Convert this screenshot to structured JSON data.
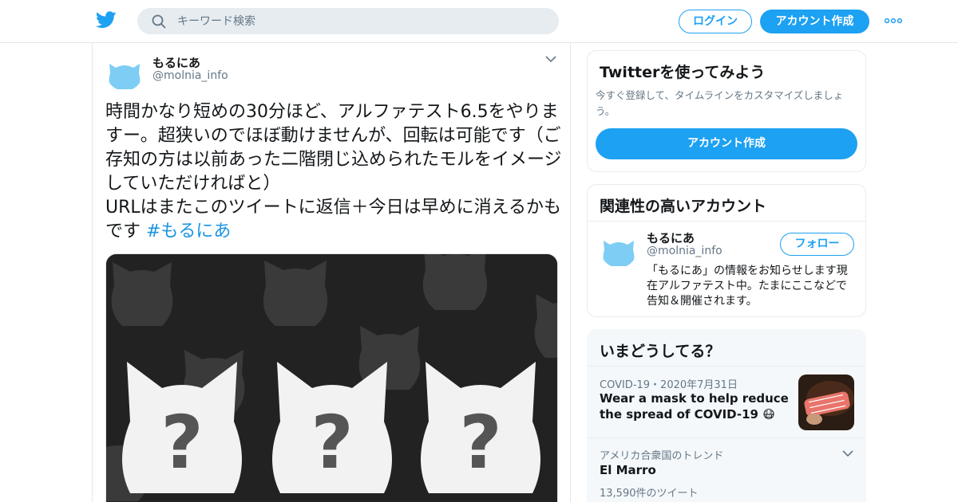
{
  "header": {
    "search_placeholder": "キーワード検索",
    "login_label": "ログイン",
    "signup_label": "アカウント作成"
  },
  "tweet": {
    "display_name": "もるにあ",
    "handle": "@molnia_info",
    "text": "時間かなり短めの30分ほど、アルファテスト6.5をやりますー。超狭いのでほぼ動けませんが、回転は可能です（ご存知の方は以前あった二階閉じ込められたモルをイメージしていただければと）\nURLはまたこのツイートに返信＋今日は早めに消えるかもです ",
    "hashtag": "#もるにあ",
    "media_question_marks": [
      "?",
      "?",
      "?"
    ]
  },
  "signup_card": {
    "title": "Twitterを使ってみよう",
    "description": "今すぐ登録して、タイムラインをカスタマイズしましょう。",
    "button_label": "アカウント作成"
  },
  "related_card": {
    "title": "関連性の高いアカウント",
    "account": {
      "display_name": "もるにあ",
      "handle": "@molnia_info",
      "follow_label": "フォロー",
      "bio": "「もるにあ」の情報をお知らせします現在アルファテスト中。たまにここなどで告知＆開催されます。"
    }
  },
  "trends_card": {
    "title": "いまどうしてる？",
    "items": [
      {
        "meta": "COVID-19・2020年7月31日",
        "title": "Wear a mask to help reduce the spread of COVID-19 😷"
      },
      {
        "meta": "アメリカ合衆国のトレンド",
        "title": "El Marro",
        "count": "13,590件のツイート"
      }
    ]
  },
  "colors": {
    "brand": "#1da1f2",
    "link": "#1b95e0",
    "avatar_blue": "#7ecdf5",
    "media_bg": "#222222"
  },
  "icons": [
    "twitter-bird-icon",
    "search-icon",
    "more-icon",
    "chevron-down-icon"
  ]
}
